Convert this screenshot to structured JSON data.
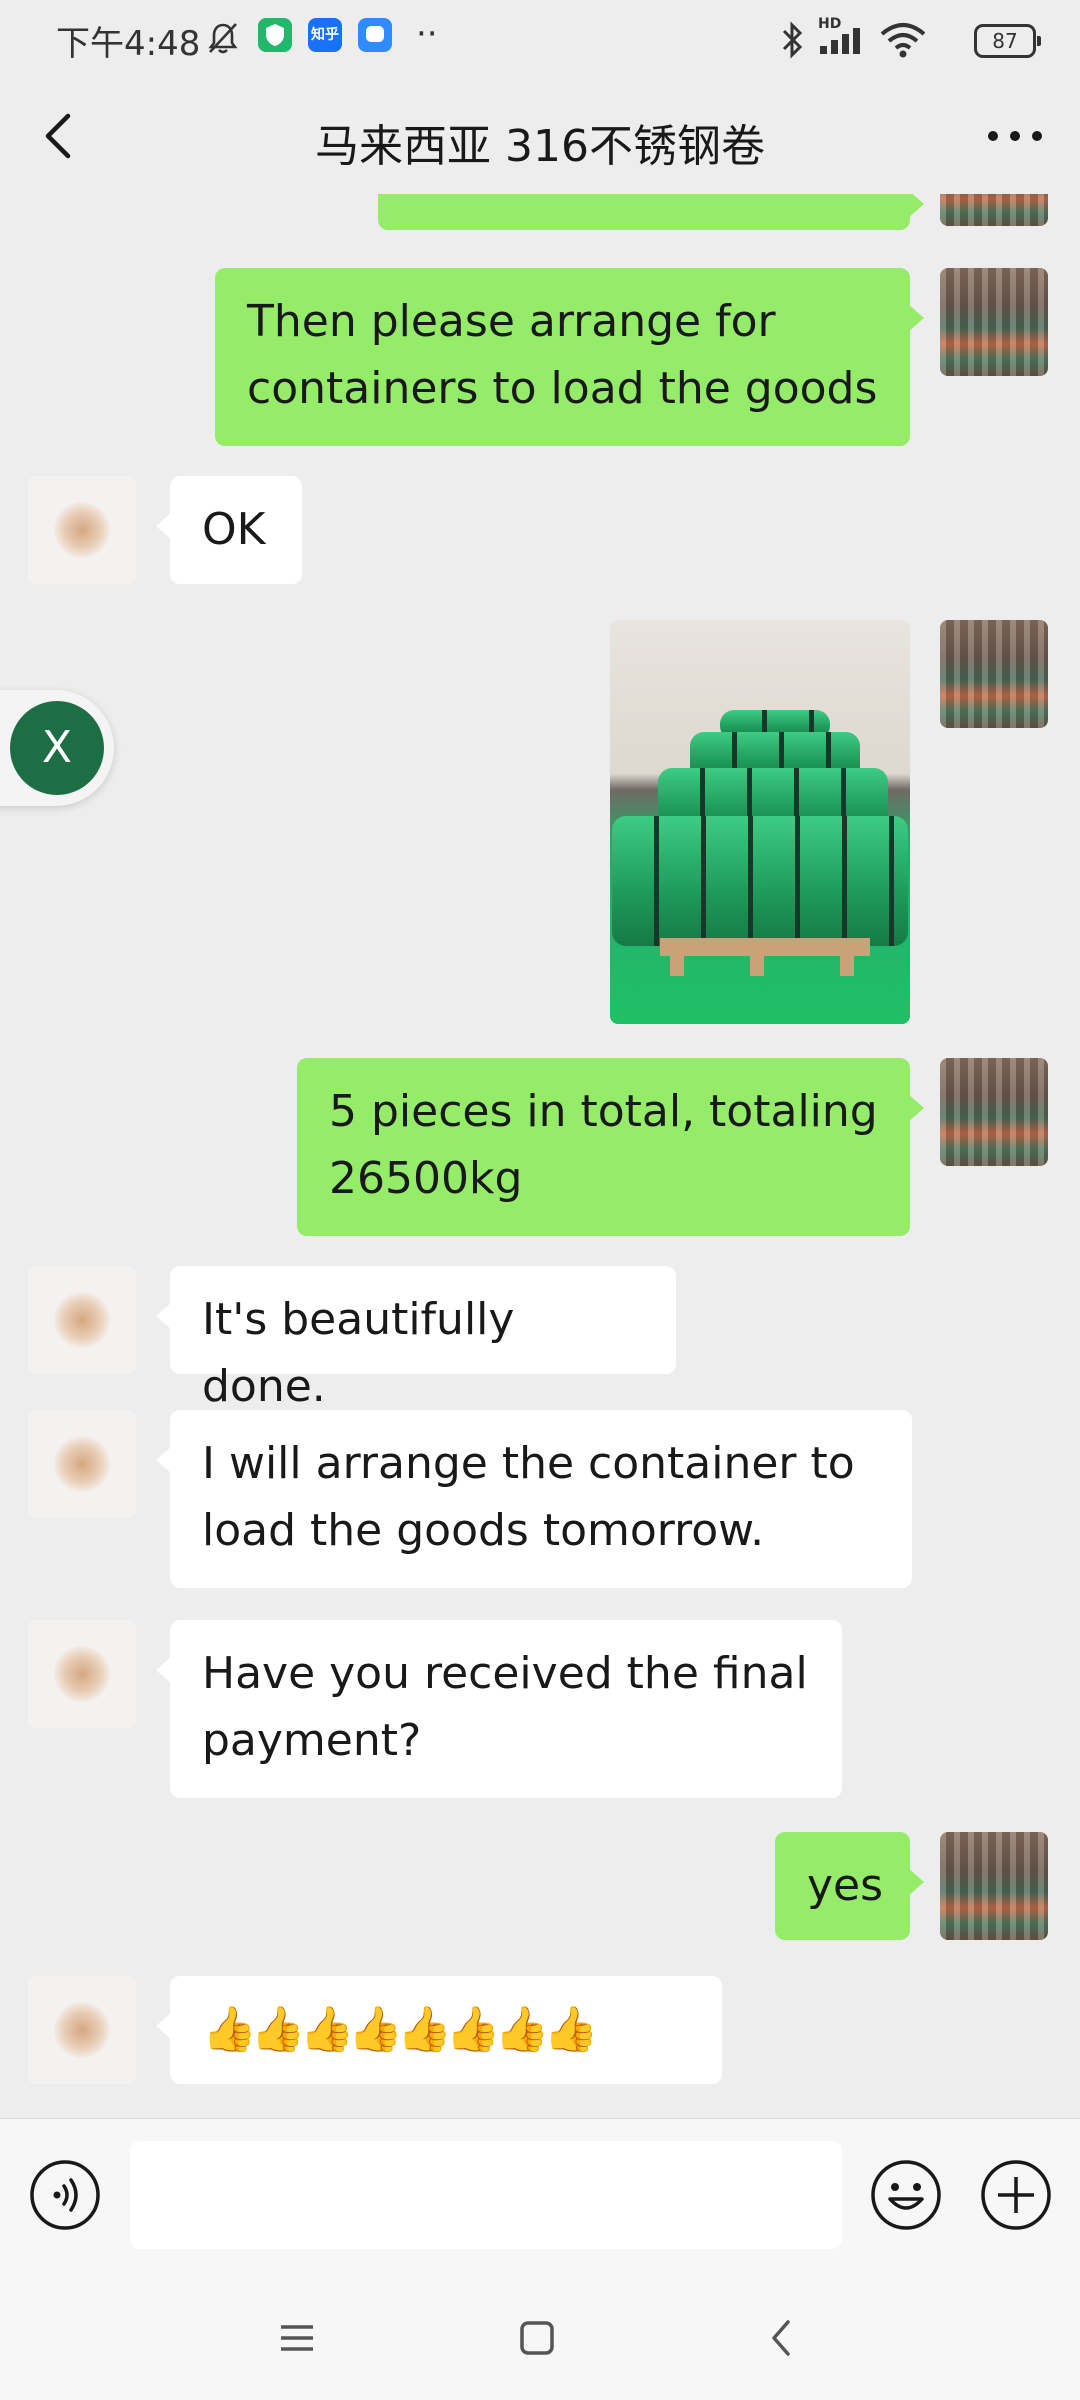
{
  "status_bar": {
    "time": "下午4:48",
    "app_badge_zhihu": "知乎",
    "signal_label": "HD",
    "more_dots": "··",
    "battery": "87"
  },
  "header": {
    "title": "马来西亚  316不锈钢卷"
  },
  "messages": [
    {
      "from": "me",
      "text": "Then please arrange for containers to load the goods"
    },
    {
      "from": "other",
      "text": "OK"
    },
    {
      "from": "me",
      "type": "image",
      "content": "green steel coils on pallets"
    },
    {
      "from": "me",
      "text": "5 pieces in total, totaling 26500kg"
    },
    {
      "from": "other",
      "text": "It's beautifully done."
    },
    {
      "from": "other",
      "text": "I will arrange the container to load the goods tomorrow."
    },
    {
      "from": "other",
      "text": "Have you received the final payment?"
    },
    {
      "from": "me",
      "text": "yes"
    },
    {
      "from": "other",
      "text": "👍👍👍👍👍👍👍👍"
    }
  ],
  "floating_button": {
    "label": "X"
  },
  "input": {
    "value": "",
    "placeholder": ""
  },
  "colors": {
    "my_bubble": "#95ec69",
    "other_bubble": "#ffffff",
    "background": "#ededed",
    "float_button": "#1e6e45"
  }
}
